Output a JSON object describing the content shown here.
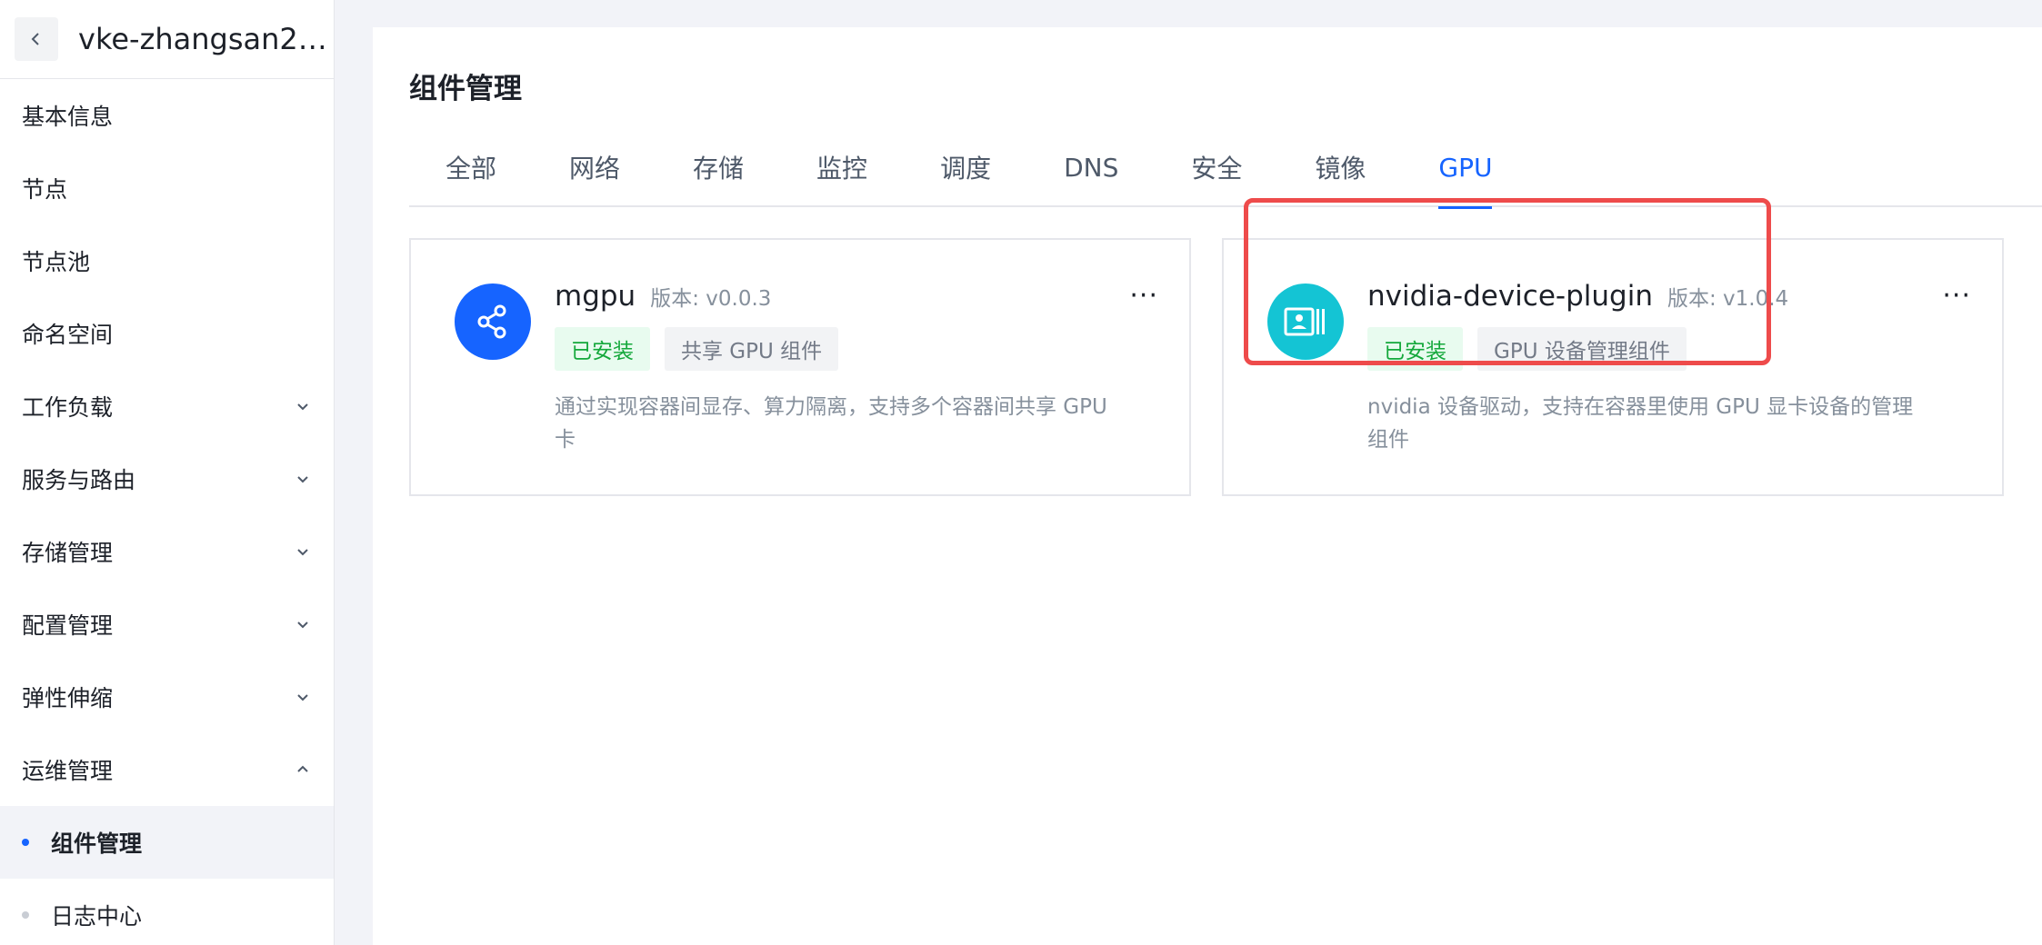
{
  "sidebar": {
    "cluster_name": "vke-zhangsan2…",
    "items": [
      {
        "label": "基本信息"
      },
      {
        "label": "节点"
      },
      {
        "label": "节点池"
      },
      {
        "label": "命名空间"
      },
      {
        "label": "工作负载"
      },
      {
        "label": "服务与路由"
      },
      {
        "label": "存储管理"
      },
      {
        "label": "配置管理"
      },
      {
        "label": "弹性伸缩"
      },
      {
        "label": "运维管理"
      }
    ],
    "sub_items": [
      {
        "label": "组件管理"
      },
      {
        "label": "日志中心"
      }
    ]
  },
  "main": {
    "title": "组件管理",
    "tabs": [
      {
        "label": "全部"
      },
      {
        "label": "网络"
      },
      {
        "label": "存储"
      },
      {
        "label": "监控"
      },
      {
        "label": "调度"
      },
      {
        "label": "DNS"
      },
      {
        "label": "安全"
      },
      {
        "label": "镜像"
      },
      {
        "label": "GPU"
      }
    ],
    "active_tab": "GPU",
    "cards": [
      {
        "name": "mgpu",
        "version": "版本: v0.0.3",
        "status": "已安装",
        "category": "共享 GPU 组件",
        "description": "通过实现容器间显存、算力隔离，支持多个容器间共享 GPU 卡",
        "icon": "share-nodes-icon",
        "icon_color": "#1664ff",
        "more": "···"
      },
      {
        "name": "nvidia-device-plugin",
        "version": "版本: v1.0.4",
        "status": "已安装",
        "category": "GPU 设备管理组件",
        "description": "nvidia 设备驱动，支持在容器里使用 GPU 显卡设备的管理组件",
        "icon": "device-card-icon",
        "icon_color": "#14c4d4",
        "more": "···"
      }
    ]
  },
  "colors": {
    "accent": "#1664ff",
    "installed_text": "#14a83b",
    "installed_bg": "#e8fbef",
    "highlight": "#ee4b4b"
  }
}
